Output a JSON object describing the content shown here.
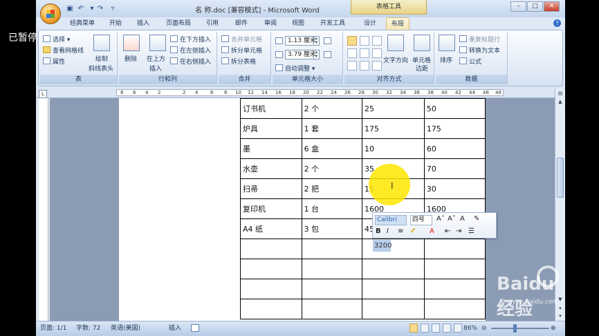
{
  "overlay": {
    "pause_label": "已暂停"
  },
  "window": {
    "title": "名 称.doc [兼容模式] - Microsoft Word",
    "context_tab_group": "表格工具",
    "controls": {
      "minimize": "–",
      "maximize": "□",
      "close": "✕"
    }
  },
  "tabs": [
    "经典菜单",
    "开始",
    "插入",
    "页面布局",
    "引用",
    "邮件",
    "审阅",
    "视图",
    "开发工具",
    "设计",
    "布局"
  ],
  "active_tab": "布局",
  "ribbon": {
    "table": {
      "select": "选择",
      "gridlines": "查看网格线",
      "properties": "属性",
      "draw_diag_1": "绘制",
      "draw_diag_2": "斜线表头",
      "label": "表"
    },
    "rows_cols": {
      "delete": "删除",
      "insert_above_1": "在上方",
      "insert_above_2": "插入",
      "insert_below": "在下方插入",
      "insert_left": "在左侧插入",
      "insert_right": "在右侧插入",
      "label": "行和列"
    },
    "merge": {
      "merge_cells": "合并单元格",
      "split_cells": "拆分单元格",
      "split_table": "拆分表格",
      "label": "合并"
    },
    "cell_size": {
      "height": "1.13 厘米",
      "width": "3.79 厘米",
      "autofit": "自动调整",
      "label": "单元格大小"
    },
    "alignment": {
      "text_direction": "文字方向",
      "margins_1": "单元格",
      "margins_2": "边距",
      "label": "对齐方式"
    },
    "data": {
      "sort": "排序",
      "repeat_header": "重复标题行",
      "convert_text": "转换为文本",
      "formula": "公式",
      "label": "数据"
    }
  },
  "ruler": {
    "ticks": [
      "8",
      "6",
      "4",
      "2",
      "2",
      "4",
      "6",
      "8",
      "10",
      "12",
      "14",
      "16",
      "18",
      "20",
      "22",
      "24",
      "26",
      "28",
      "30",
      "32",
      "34",
      "36",
      "38",
      "40",
      "42",
      "44",
      "46",
      "48"
    ]
  },
  "table": {
    "rows": [
      [
        "订书机",
        "2 个",
        "25",
        "50"
      ],
      [
        "炉具",
        "1 套",
        "175",
        "175"
      ],
      [
        "墨",
        "6 盒",
        "10",
        "60"
      ],
      [
        "水壶",
        "2 个",
        "35",
        "70"
      ],
      [
        "扫帚",
        "2 把",
        "15",
        "30"
      ],
      [
        "复印机",
        "1 台",
        "1600",
        "1600"
      ],
      [
        "A4 纸",
        "3 包",
        "45",
        ""
      ],
      [
        "",
        "",
        "",
        ""
      ],
      [
        "",
        "",
        "",
        ""
      ],
      [
        "",
        "",
        "",
        ""
      ],
      [
        "",
        "",
        "",
        ""
      ]
    ]
  },
  "mini_toolbar": {
    "font": "Calibri",
    "size": "四号"
  },
  "selected_value": "3200",
  "status": {
    "page": "页面: 1/1",
    "words": "字数: 72",
    "lang": "英语(美国)",
    "mode": "插入",
    "zoom": "86%"
  },
  "watermark": {
    "text": "Baidu 经验",
    "url": "jingyan.baidu.com"
  }
}
